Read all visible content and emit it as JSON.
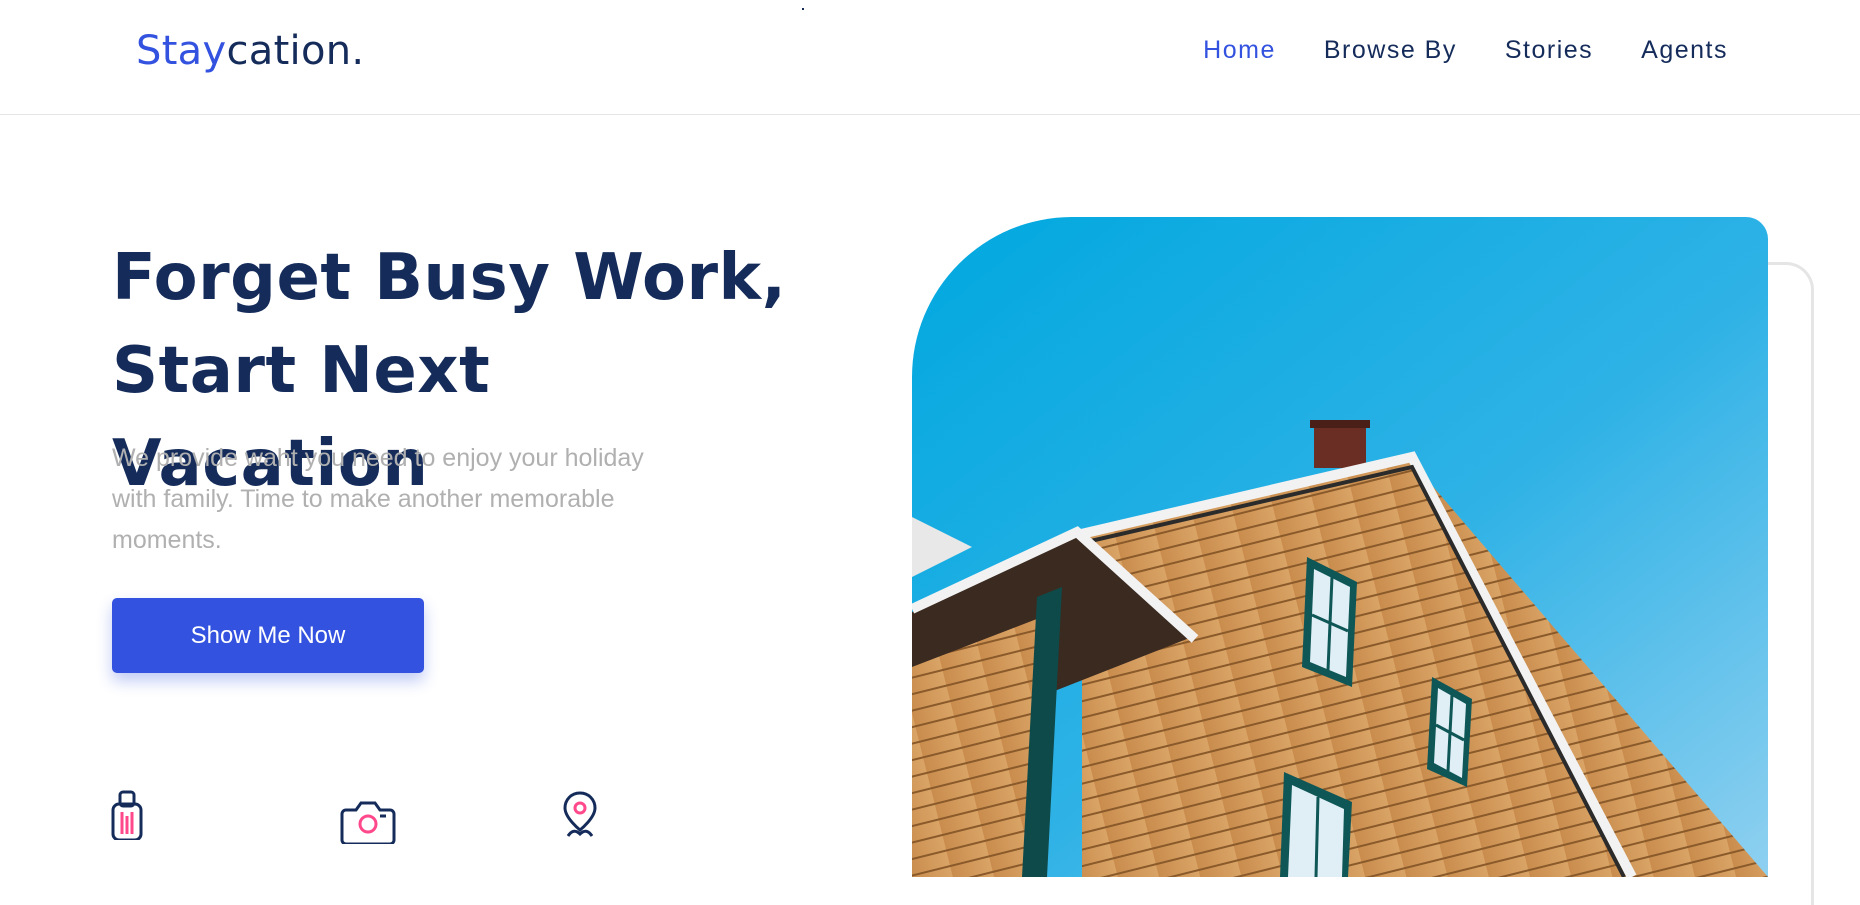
{
  "header": {
    "logo_accent": "Stay",
    "logo_rest": "cation.",
    "nav": [
      {
        "label": "Home",
        "active": true
      },
      {
        "label": "Browse By",
        "active": false
      },
      {
        "label": "Stories",
        "active": false
      },
      {
        "label": "Agents",
        "active": false
      }
    ]
  },
  "hero": {
    "title_line1": "Forget Busy Work,",
    "title_line2": "Start Next Vacation",
    "description": "We provide waht you need to enjoy your holiday with family. Time to make another memorable moments.",
    "cta_label": "Show Me Now",
    "stat_icons": [
      "suitcase-icon",
      "camera-icon",
      "map-pin-icon"
    ],
    "image_alt": "house-photo"
  },
  "colors": {
    "accent": "#3252df",
    "navy": "#152c5b",
    "muted": "#b0b0b0",
    "pink": "#ff498b"
  }
}
